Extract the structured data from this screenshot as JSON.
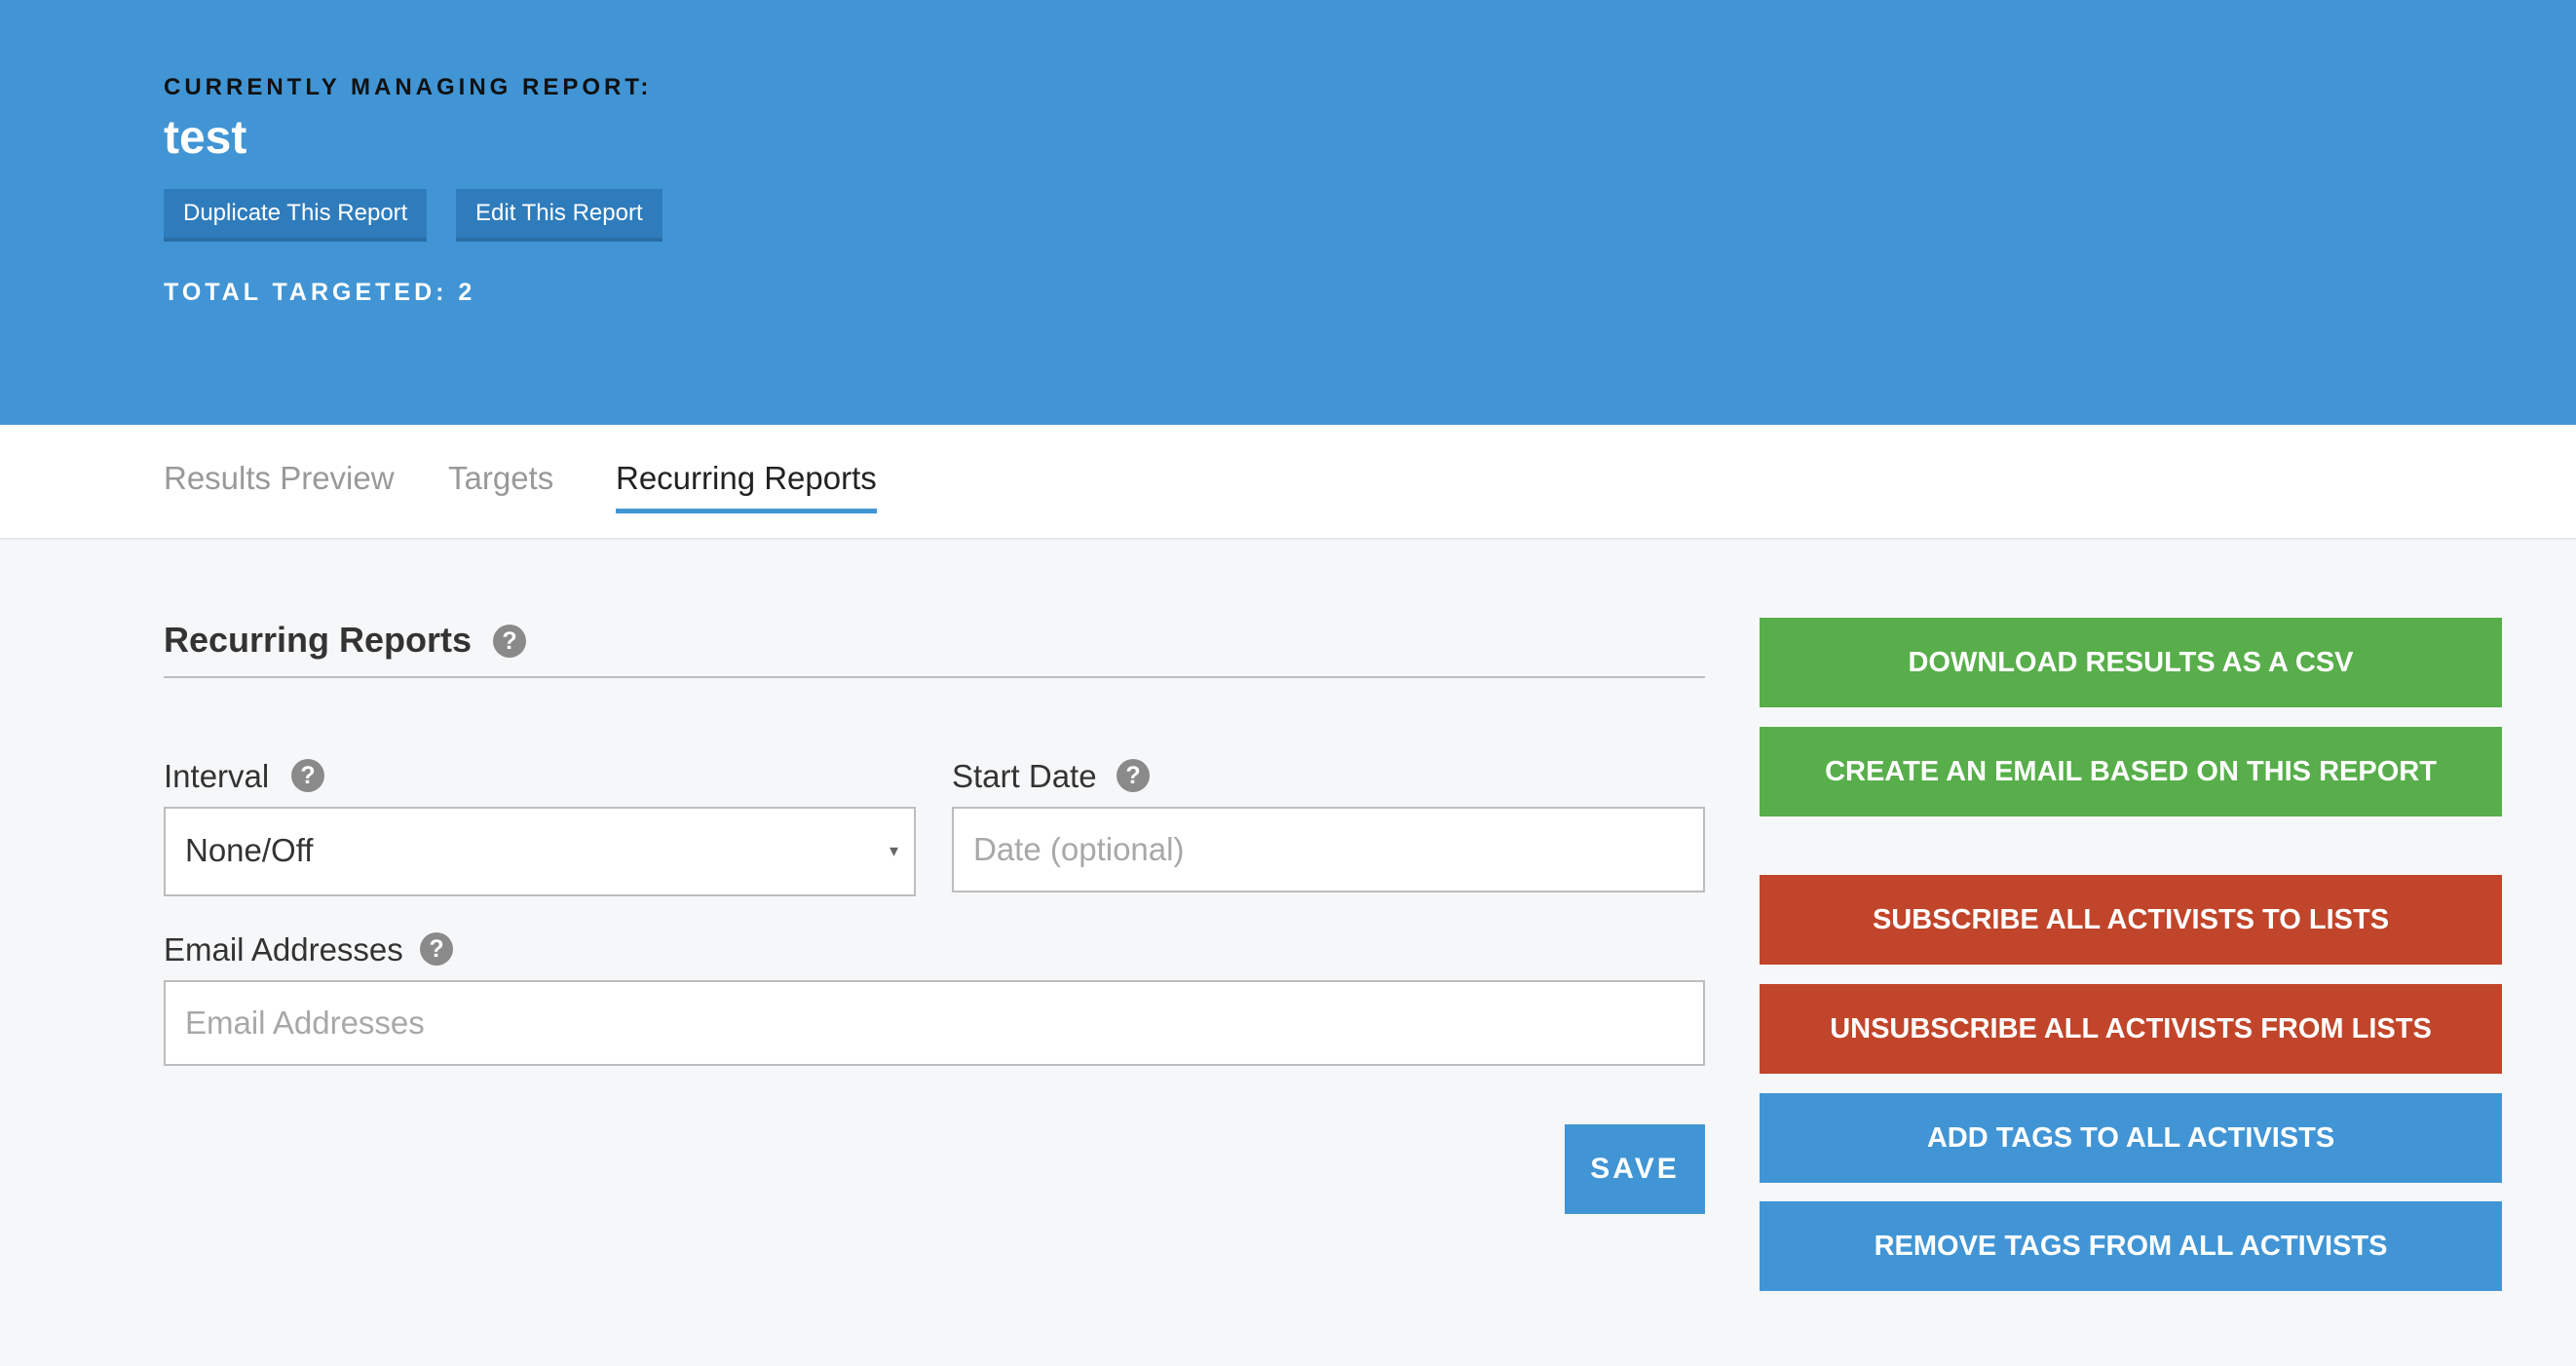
{
  "header": {
    "managing_label": "CURRENTLY MANAGING REPORT:",
    "report_name": "test",
    "duplicate_label": "Duplicate This Report",
    "edit_label": "Edit This Report",
    "total_targeted": "TOTAL TARGETED: 2"
  },
  "tabs": [
    {
      "label": "Results Preview",
      "active": false
    },
    {
      "label": "Targets",
      "active": false
    },
    {
      "label": "Recurring Reports",
      "active": true
    }
  ],
  "form": {
    "title": "Recurring Reports",
    "interval_label": "Interval",
    "interval_value": "None/Off",
    "start_date_label": "Start Date",
    "start_date_placeholder": "Date (optional)",
    "email_label": "Email Addresses",
    "email_placeholder": "Email Addresses",
    "save_label": "SAVE",
    "help_glyph": "?",
    "caret_glyph": "▾"
  },
  "actions": [
    {
      "label": "DOWNLOAD RESULTS AS A CSV",
      "color": "#57ae4a"
    },
    {
      "label": "CREATE AN EMAIL BASED ON THIS REPORT",
      "color": "#57ae4a"
    },
    {
      "label": "SUBSCRIBE ALL ACTIVISTS TO LISTS",
      "color": "#c1452a"
    },
    {
      "label": "UNSUBSCRIBE ALL ACTIVISTS FROM LISTS",
      "color": "#c1452a"
    },
    {
      "label": "ADD TAGS TO ALL ACTIVISTS",
      "color": "#4195d5"
    },
    {
      "label": "REMOVE TAGS FROM ALL ACTIVISTS",
      "color": "#4195d5"
    }
  ],
  "colors": {
    "header_bg": "#4195d5",
    "header_button": "#2f7cbc",
    "tab_underline": "#4195d5",
    "page_bg": "#f6f7f8"
  }
}
